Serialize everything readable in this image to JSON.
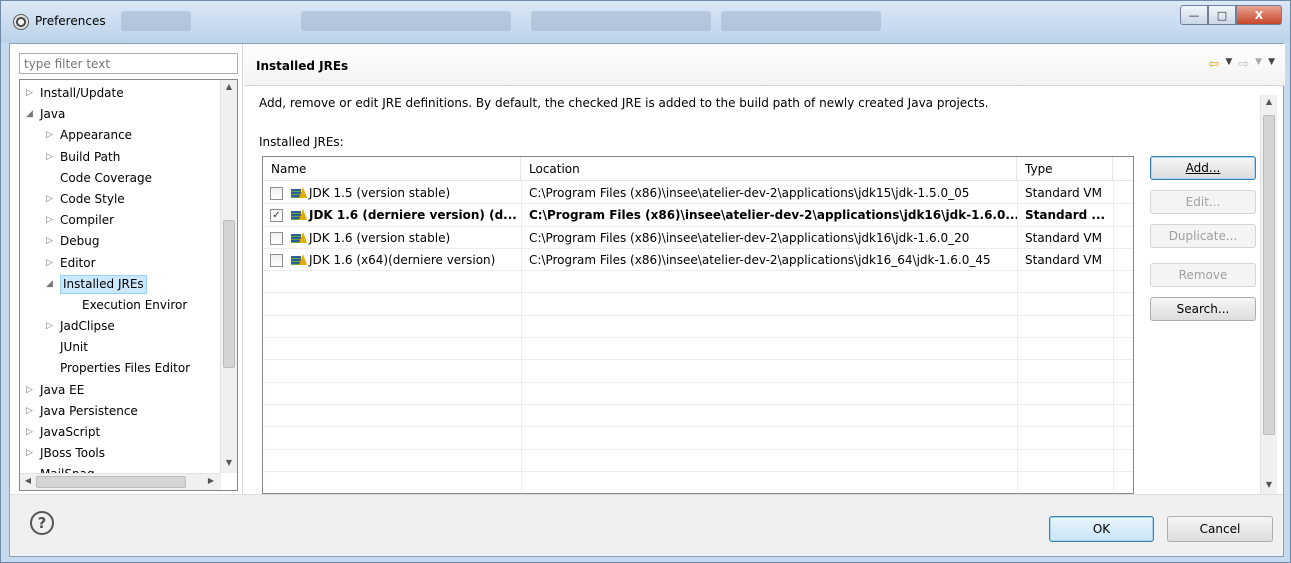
{
  "window": {
    "title": "Preferences",
    "controls": {
      "minimize": "—",
      "maximize": "□",
      "close": "X"
    }
  },
  "filter": {
    "placeholder": "type filter text"
  },
  "tree": {
    "items": [
      {
        "label": "Install/Update",
        "level": 0,
        "expander": "collapsed"
      },
      {
        "label": "Java",
        "level": 0,
        "expander": "expanded"
      },
      {
        "label": "Appearance",
        "level": 1,
        "expander": "collapsed"
      },
      {
        "label": "Build Path",
        "level": 1,
        "expander": "collapsed"
      },
      {
        "label": "Code Coverage",
        "level": 1,
        "expander": "none"
      },
      {
        "label": "Code Style",
        "level": 1,
        "expander": "collapsed"
      },
      {
        "label": "Compiler",
        "level": 1,
        "expander": "collapsed"
      },
      {
        "label": "Debug",
        "level": 1,
        "expander": "collapsed"
      },
      {
        "label": "Editor",
        "level": 1,
        "expander": "collapsed"
      },
      {
        "label": "Installed JREs",
        "level": 1,
        "expander": "expanded",
        "selected": true
      },
      {
        "label": "Execution Enviror",
        "level": 2,
        "expander": "none"
      },
      {
        "label": "JadClipse",
        "level": 1,
        "expander": "collapsed"
      },
      {
        "label": "JUnit",
        "level": 1,
        "expander": "none"
      },
      {
        "label": "Properties Files Editor",
        "level": 1,
        "expander": "none"
      },
      {
        "label": "Java EE",
        "level": 0,
        "expander": "collapsed"
      },
      {
        "label": "Java Persistence",
        "level": 0,
        "expander": "collapsed"
      },
      {
        "label": "JavaScript",
        "level": 0,
        "expander": "collapsed"
      },
      {
        "label": "JBoss Tools",
        "level": 0,
        "expander": "collapsed"
      },
      {
        "label": "MailSnag",
        "level": 0,
        "expander": "none"
      }
    ]
  },
  "page": {
    "title": "Installed JREs",
    "description": "Add, remove or edit JRE definitions. By default, the checked JRE is added to the build path of newly created Java projects.",
    "list_label": "Installed JREs:",
    "columns": [
      "Name",
      "Location",
      "Type"
    ],
    "rows": [
      {
        "checked": false,
        "bold": false,
        "name": "JDK 1.5 (version stable)",
        "location": "C:\\Program Files (x86)\\insee\\atelier-dev-2\\applications\\jdk15\\jdk-1.5.0_05",
        "type": "Standard VM"
      },
      {
        "checked": true,
        "bold": true,
        "name": "JDK 1.6 (derniere version) (d...",
        "location": "C:\\Program Files (x86)\\insee\\atelier-dev-2\\applications\\jdk16\\jdk-1.6.0...",
        "type": "Standard ..."
      },
      {
        "checked": false,
        "bold": false,
        "name": "JDK 1.6 (version stable)",
        "location": "C:\\Program Files (x86)\\insee\\atelier-dev-2\\applications\\jdk16\\jdk-1.6.0_20",
        "type": "Standard VM"
      },
      {
        "checked": false,
        "bold": false,
        "name": "JDK 1.6 (x64)(derniere version)",
        "location": "C:\\Program Files (x86)\\insee\\atelier-dev-2\\applications\\jdk16_64\\jdk-1.6.0_45",
        "type": "Standard VM"
      }
    ],
    "buttons": {
      "add": "Add...",
      "edit": "Edit...",
      "duplicate": "Duplicate...",
      "remove": "Remove",
      "search": "Search..."
    }
  },
  "footer": {
    "ok": "OK",
    "cancel": "Cancel"
  },
  "colors": {
    "accent": "#3c7fb1",
    "selection": "#cce8ff",
    "nav_back": "#d8a200"
  },
  "icons": [
    "preferences-icon",
    "help-icon",
    "nav-back-icon",
    "nav-forward-icon",
    "jre-icon"
  ]
}
